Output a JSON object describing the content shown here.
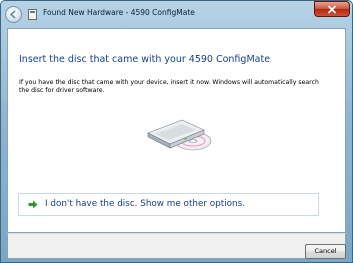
{
  "window": {
    "title": "Found New Hardware - 4590 ConfigMate"
  },
  "dialog": {
    "heading": "Insert the disc that came with your 4590 ConfigMate",
    "description": "If you have the disc that came with your device, insert it now.  Windows will automatically search the disc for driver software.",
    "option_label": "I don't have the disc.  Show me other options."
  },
  "footer": {
    "cancel_label": "Cancel"
  },
  "icons": {
    "close": "close-icon",
    "back": "back-arrow-icon",
    "wizard": "hardware-wizard-icon",
    "disc": "disc-drive-icon",
    "option_arrow": "green-arrow-icon"
  },
  "colors": {
    "title_bar": "#8fb6cf",
    "heading_text": "#1a3f8a",
    "close_button": "#c9533c",
    "option_arrow": "#2e9a2e"
  }
}
